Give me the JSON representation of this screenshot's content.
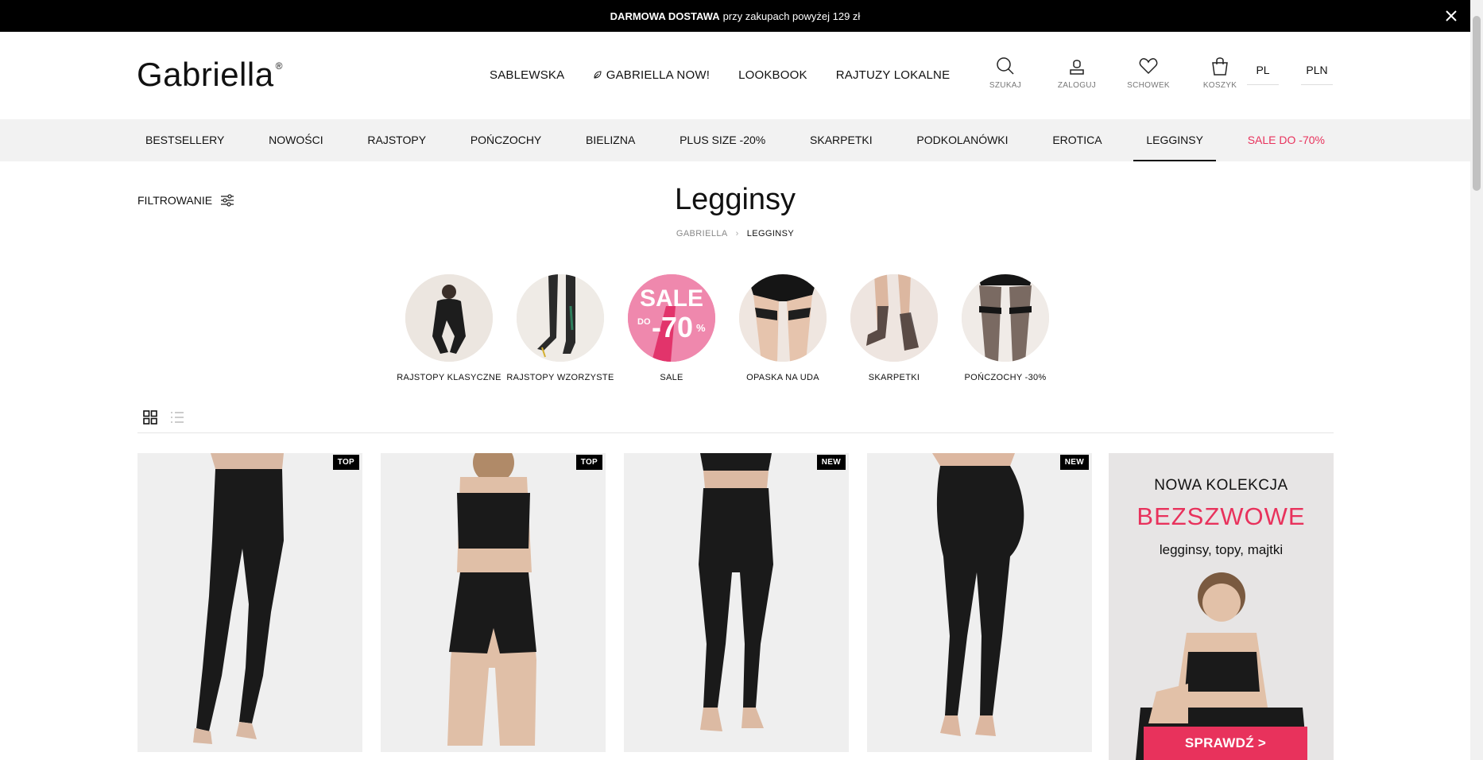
{
  "promo_bar": {
    "bold": "DARMOWA DOSTAWA",
    "text": "przy zakupach powyżej 129 zł"
  },
  "header": {
    "logo": "Gabriella",
    "logo_mark": "®",
    "nav": [
      "SABLEWSKA",
      "GABRIELLA NOW!",
      "LOOKBOOK",
      "RAJTUZY LOKALNE"
    ],
    "icons": [
      {
        "label": "SZUKAJ",
        "icon": "search-icon"
      },
      {
        "label": "ZALOGUJ",
        "icon": "user-icon"
      },
      {
        "label": "SCHOWEK",
        "icon": "heart-icon"
      },
      {
        "label": "KOSZYK",
        "icon": "bag-icon"
      }
    ],
    "language": "PL",
    "currency": "PLN"
  },
  "categories": [
    {
      "label": "BESTSELLERY"
    },
    {
      "label": "NOWOŚCI"
    },
    {
      "label": "RAJSTOPY"
    },
    {
      "label": "POŃCZOCHY"
    },
    {
      "label": "BIELIZNA"
    },
    {
      "label": "PLUS SIZE -20%"
    },
    {
      "label": "SKARPETKI"
    },
    {
      "label": "PODKOLANÓWKI"
    },
    {
      "label": "EROTICA"
    },
    {
      "label": "LEGGINSY",
      "active": true
    },
    {
      "label": "SALE DO -70%",
      "sale": true
    }
  ],
  "page": {
    "filter_label": "FILTROWANIE",
    "title": "Legginsy",
    "breadcrumb": {
      "home": "GABRIELLA",
      "current": "LEGGINSY"
    }
  },
  "subcategories": [
    "RAJSTOPY KLASYCZNE",
    "RAJSTOPY WZORZYSTE",
    "SALE",
    "OPASKA NA UDA",
    "SKARPETKI",
    "POŃCZOCHY -30%"
  ],
  "sale_circle": {
    "word": "SALE",
    "prefix": "DO",
    "value": "-70",
    "unit": "%"
  },
  "products": [
    {
      "badge": "TOP"
    },
    {
      "badge": "TOP"
    },
    {
      "badge": "NEW"
    },
    {
      "badge": "NEW"
    }
  ],
  "promo": {
    "line1": "NOWA KOLEKCJA",
    "line2": "BEZSZWOWE",
    "line3": "legginsy, topy, majtki",
    "cta": "SPRAWDŹ >"
  },
  "colors": {
    "accent": "#e8325c",
    "topbar": "#000000",
    "catnav_bg": "#f2f2f2"
  }
}
